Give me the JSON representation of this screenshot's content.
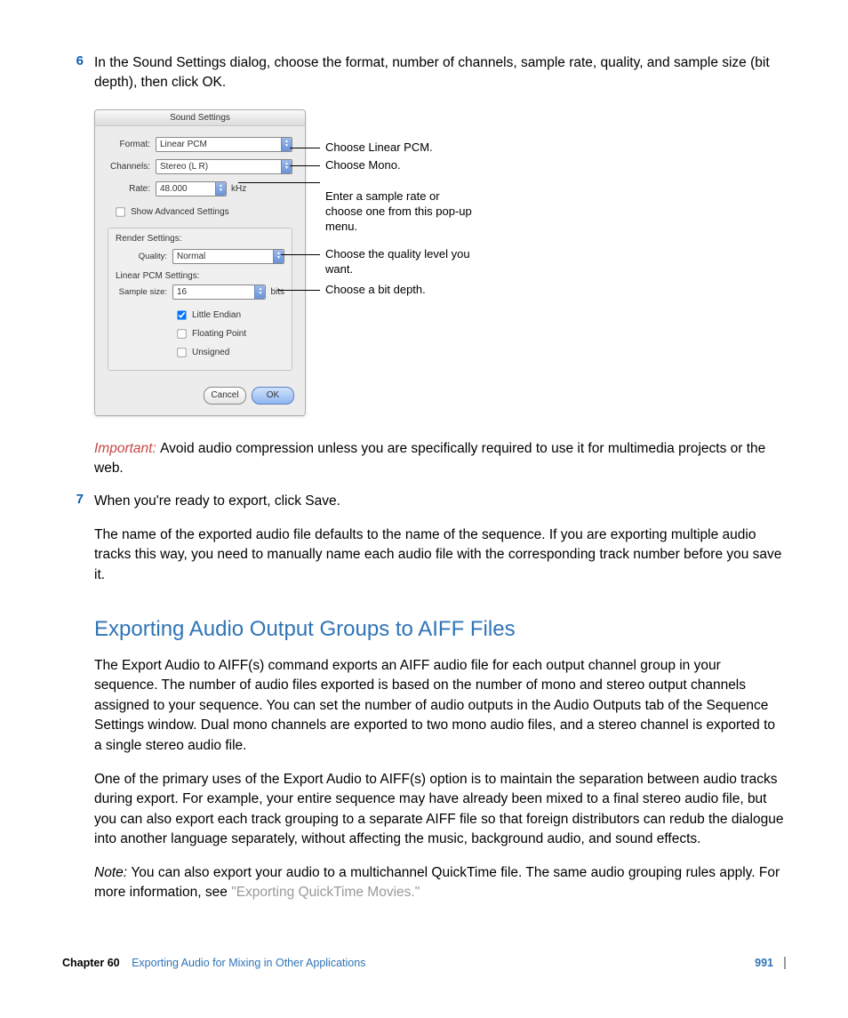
{
  "step6": {
    "num": "6",
    "text": "In the Sound Settings dialog, choose the format, number of channels, sample rate, quality, and sample size (bit depth), then click OK."
  },
  "dialog": {
    "title": "Sound Settings",
    "format_label": "Format:",
    "format_value": "Linear PCM",
    "channels_label": "Channels:",
    "channels_value": "Stereo (L R)",
    "rate_label": "Rate:",
    "rate_value": "48.000",
    "rate_unit": "kHz",
    "advanced_label": "Show Advanced Settings",
    "render_title": "Render Settings:",
    "quality_label": "Quality:",
    "quality_value": "Normal",
    "pcm_title": "Linear PCM Settings:",
    "samplesize_label": "Sample size:",
    "samplesize_value": "16",
    "samplesize_unit": "bits",
    "little_endian": "Little Endian",
    "floating_point": "Floating Point",
    "unsigned": "Unsigned",
    "cancel": "Cancel",
    "ok": "OK"
  },
  "callouts": {
    "c1": "Choose Linear PCM.",
    "c2": "Choose Mono.",
    "c3": "Enter a sample rate or choose one from this pop-up menu.",
    "c4": "Choose the quality level you want.",
    "c5": "Choose a bit depth."
  },
  "important": {
    "label": "Important:  ",
    "text": "Avoid audio compression unless you are specifically required to use it for multimedia projects or the web."
  },
  "step7": {
    "num": "7",
    "text": "When you're ready to export, click Save.",
    "para": "The name of the exported audio file defaults to the name of the sequence. If you are exporting multiple audio tracks this way, you need to manually name each audio file with the corresponding track number before you save it."
  },
  "section": {
    "heading": "Exporting Audio Output Groups to AIFF Files",
    "p1": "The Export Audio to AIFF(s) command exports an AIFF audio file for each output channel group in your sequence. The number of audio files exported is based on the number of mono and stereo output channels assigned to your sequence. You can set the number of audio outputs in the Audio Outputs tab of the Sequence Settings window. Dual mono channels are exported to two mono audio files, and a stereo channel is exported to a single stereo audio file.",
    "p2": "One of the primary uses of the Export Audio to AIFF(s) option is to maintain the separation between audio tracks during export. For example, your entire sequence may have already been mixed to a final stereo audio file, but you can also export each track grouping to a separate AIFF file so that foreign distributors can redub the dialogue into another language separately, without affecting the music, background audio, and sound effects.",
    "note_label": "Note:  ",
    "note_text": "You can also export your audio to a multichannel QuickTime file. The same audio grouping rules apply. For more information, see ",
    "note_link": "\"Exporting QuickTime Movies.\""
  },
  "footer": {
    "chapter": "Chapter 60",
    "title": "Exporting Audio for Mixing in Other Applications",
    "page": "991"
  }
}
